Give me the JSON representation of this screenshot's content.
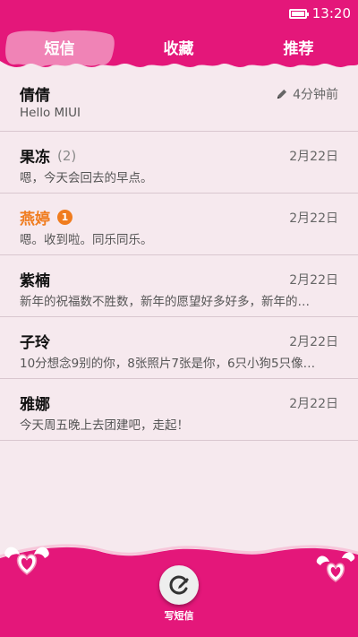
{
  "status_bar": {
    "time": "13:20"
  },
  "tabs": [
    {
      "label": "短信",
      "active": true
    },
    {
      "label": "收藏",
      "active": false
    },
    {
      "label": "推荐",
      "active": false
    }
  ],
  "conversations": [
    {
      "name": "倩倩",
      "count": "",
      "unread": "",
      "time": "4分钟前",
      "draft": true,
      "preview": "Hello MIUI"
    },
    {
      "name": "果冻",
      "count": "(2)",
      "unread": "",
      "time": "2月22日",
      "draft": false,
      "preview": "嗯，今天会回去的早点。"
    },
    {
      "name": "燕婷",
      "count": "",
      "unread": "1",
      "time": "2月22日",
      "draft": false,
      "preview": "嗯。收到啦。同乐同乐。"
    },
    {
      "name": "紫楠",
      "count": "",
      "unread": "",
      "time": "2月22日",
      "draft": false,
      "preview": "新年的祝福数不胜数，新年的愿望好多好多，新年的…"
    },
    {
      "name": "子玲",
      "count": "",
      "unread": "",
      "time": "2月22日",
      "draft": false,
      "preview": "10分想念9别的你，8张照片7张是你，6只小狗5只像…"
    },
    {
      "name": "雅娜",
      "count": "",
      "unread": "",
      "time": "2月22日",
      "draft": false,
      "preview": "今天周五晚上去团建吧，走起！"
    }
  ],
  "compose": {
    "label": "写短信",
    "icon": "compose-icon"
  },
  "colors": {
    "accent": "#e4177a",
    "unread": "#f07c1e",
    "background": "#f6e9ee"
  }
}
